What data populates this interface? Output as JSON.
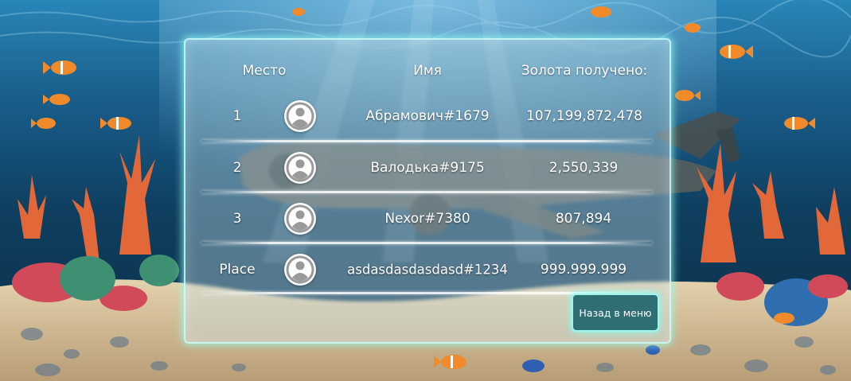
{
  "leaderboard": {
    "headers": {
      "place": "Место",
      "name": "Имя",
      "gold": "Золота получено:"
    },
    "rows": [
      {
        "place": "1",
        "name": "Абрамович#1679",
        "gold": "107,199,872,478",
        "avatar_icon": "user-avatar-icon"
      },
      {
        "place": "2",
        "name": "Валодька#9175",
        "gold": "2,550,339",
        "avatar_icon": "user-avatar-icon"
      },
      {
        "place": "3",
        "name": "Nexor#7380",
        "gold": "807,894",
        "avatar_icon": "user-avatar-icon"
      },
      {
        "place": "Place",
        "name": "asdasdasdasdasd#1234",
        "gold": "999.999.999",
        "avatar_icon": "user-avatar-icon"
      }
    ]
  },
  "buttons": {
    "back_label": "Назад в меню"
  },
  "colors": {
    "panel_border": "#9ef5ee",
    "button_fill": "#2f6f74",
    "text": "#ffffff",
    "water_top": "#0b3a5e",
    "sand": "#cdbb98"
  }
}
